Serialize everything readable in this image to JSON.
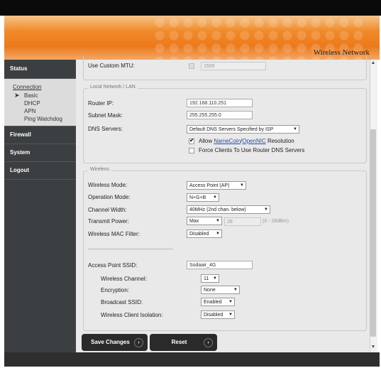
{
  "header": {
    "title": "Wireless Network"
  },
  "sidebar": {
    "status": "Status",
    "connection": {
      "title": "Connection",
      "items": [
        "Basic",
        "DHCP",
        "APN",
        "Ping Watchdog"
      ]
    },
    "firewall": "Firewall",
    "system": "System",
    "logout": "Logout"
  },
  "mtu": {
    "label": "Use Custom MTU:",
    "value": "1500"
  },
  "lan": {
    "legend": "Local Network / LAN",
    "router_ip_label": "Router IP:",
    "router_ip": "192.168.110.251",
    "subnet_label": "Subnet Mask:",
    "subnet": "255.255.255.0",
    "dns_label": "DNS Servers:",
    "dns_value": "Default DNS Servers Specified by ISP",
    "allow_prefix": "Allow ",
    "namecoin": "NameCoin",
    "slash": "/",
    "opennic": "OpenNIC",
    "allow_suffix": " Resolution",
    "force_label": "Force Clients To Use Router DNS Servers"
  },
  "wireless": {
    "legend": "Wireless",
    "mode_label": "Wireless Mode:",
    "mode_value": "Access Point (AP)",
    "op_label": "Operation Mode:",
    "op_value": "N+G+B",
    "width_label": "Channel Width:",
    "width_value": "40MHz (2nd chan. below)",
    "power_label": "Transmit Power:",
    "power_value": "Max",
    "power_num": "28",
    "power_unit": "(0 - 28dBm)",
    "mac_label": "Wireless MAC Filter:",
    "mac_value": "Disabled",
    "ssid_label": "Access Point SSID:",
    "ssid_value": "Sodaair_4G",
    "channel_label": "Wireless Channel:",
    "channel_value": "11",
    "enc_label": "Encryption:",
    "enc_value": "None",
    "bcast_label": "Broadcast SSID:",
    "bcast_value": "Enabled",
    "iso_label": "Wireless Client Isolation:",
    "iso_value": "Disabled"
  },
  "buttons": {
    "save": "Save Changes",
    "reset": "Reset"
  }
}
